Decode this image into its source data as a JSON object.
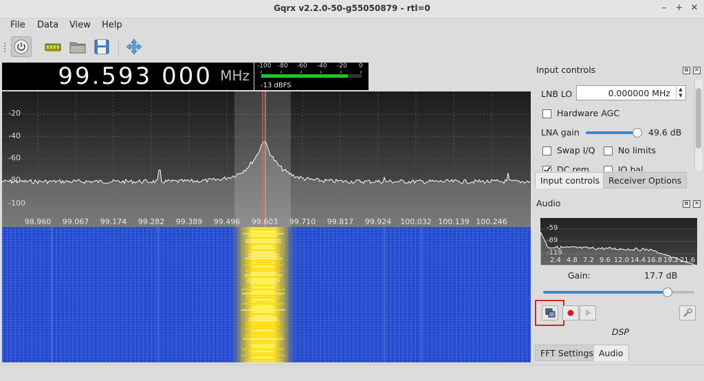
{
  "window": {
    "title": "Gqrx v2.2.0-50-g55050879 - rtl=0",
    "controls": [
      "–",
      "+",
      "✕"
    ]
  },
  "menu": {
    "items": [
      "File",
      "Data",
      "View",
      "Help"
    ]
  },
  "toolbar": {
    "icons": [
      "power-icon",
      "hardware-icon",
      "folder-icon",
      "save-icon",
      "move-icon"
    ]
  },
  "frequency": {
    "digits": "99.593 000",
    "unit": "MHz"
  },
  "signal_meter": {
    "scale": [
      "-100",
      "-80",
      "-60",
      "-40",
      "-20",
      "0"
    ],
    "readout": "-13 dBFS",
    "level_fraction": 0.86,
    "bar_color": "#22c52b"
  },
  "spectrum": {
    "y_labels": [
      "-20",
      "-40",
      "-60",
      "-80",
      "-100"
    ],
    "x_labels": [
      "98.960",
      "99.067",
      "99.174",
      "99.282",
      "99.389",
      "99.496",
      "99.603",
      "99.710",
      "99.817",
      "99.924",
      "100.032",
      "100.139",
      "100.246"
    ],
    "colors": {
      "trace": "#ffffff",
      "center_line": "#ff6a6a",
      "filter_band": "#ffffff"
    }
  },
  "input_controls": {
    "title": "Input controls",
    "lnb_lo_label": "LNB LO",
    "lnb_lo_value": "0.000000 MHz",
    "hardware_agc": "Hardware AGC",
    "lna_gain_label": "LNA gain",
    "lna_gain_value": "49.6 dB",
    "lna_gain_fraction": 0.93,
    "swap_iq": "Swap I/Q",
    "no_limits": "No limits",
    "dc_rem": "DC rem",
    "iq_bal": "IQ bal"
  },
  "tabs_top": [
    "Input controls",
    "Receiver Options"
  ],
  "audio": {
    "title": "Audio",
    "fft_y_labels": [
      "-59",
      "-89",
      "-119"
    ],
    "fft_x_labels": [
      "2.4",
      "4.8",
      "7.2",
      "9.6",
      "12.0",
      "14.4",
      "16.8",
      "19.2",
      "21.6"
    ],
    "gain_label": "Gain:",
    "gain_value": "17.7 dB",
    "gain_fraction": 0.82,
    "dsp_label": "DSP"
  },
  "tabs_bottom": [
    "FFT Settings",
    "Audio"
  ]
}
